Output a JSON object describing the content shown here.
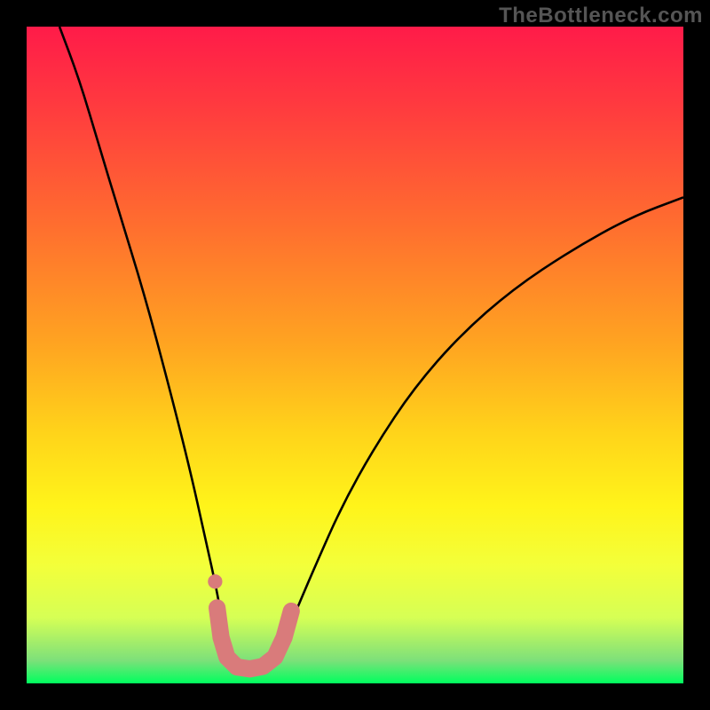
{
  "watermark": "TheBottleneck.com",
  "chart_data": {
    "type": "line",
    "title": "",
    "xlabel": "",
    "ylabel": "",
    "xlim": [
      0,
      100
    ],
    "ylim": [
      0,
      100
    ],
    "grid": false,
    "legend": false,
    "curve": {
      "description": "V-shaped bottleneck curve with minimum near x≈33",
      "points": [
        {
          "x": 5,
          "y": 100
        },
        {
          "x": 8,
          "y": 92
        },
        {
          "x": 11,
          "y": 82
        },
        {
          "x": 14,
          "y": 72
        },
        {
          "x": 18,
          "y": 59
        },
        {
          "x": 22,
          "y": 44
        },
        {
          "x": 25,
          "y": 32
        },
        {
          "x": 27,
          "y": 23
        },
        {
          "x": 29,
          "y": 14
        },
        {
          "x": 30,
          "y": 8
        },
        {
          "x": 31,
          "y": 4
        },
        {
          "x": 33,
          "y": 2
        },
        {
          "x": 35,
          "y": 2
        },
        {
          "x": 37,
          "y": 3
        },
        {
          "x": 39,
          "y": 6
        },
        {
          "x": 41,
          "y": 11
        },
        {
          "x": 44,
          "y": 18
        },
        {
          "x": 48,
          "y": 27
        },
        {
          "x": 53,
          "y": 36
        },
        {
          "x": 59,
          "y": 45
        },
        {
          "x": 66,
          "y": 53
        },
        {
          "x": 74,
          "y": 60
        },
        {
          "x": 83,
          "y": 66
        },
        {
          "x": 92,
          "y": 71
        },
        {
          "x": 100,
          "y": 74
        }
      ]
    },
    "highlight_band": {
      "description": "thick pink U segment at curve bottom",
      "points": [
        {
          "x": 29.0,
          "y": 11.5
        },
        {
          "x": 29.6,
          "y": 7.0
        },
        {
          "x": 30.5,
          "y": 4.0
        },
        {
          "x": 32.0,
          "y": 2.5
        },
        {
          "x": 34.0,
          "y": 2.2
        },
        {
          "x": 36.0,
          "y": 2.6
        },
        {
          "x": 37.8,
          "y": 4.0
        },
        {
          "x": 39.2,
          "y": 7.0
        },
        {
          "x": 40.3,
          "y": 11.0
        }
      ]
    },
    "highlight_dot": {
      "x": 28.7,
      "y": 15.5
    },
    "green_band": {
      "y_start": 1.0,
      "y_end": 3.5,
      "color_top": "#7de07a",
      "color_bottom": "#00ff5e"
    },
    "background_gradient": {
      "stops": [
        {
          "offset": 0.0,
          "color": "#ff1b49"
        },
        {
          "offset": 0.12,
          "color": "#ff3a3f"
        },
        {
          "offset": 0.3,
          "color": "#ff6d2f"
        },
        {
          "offset": 0.48,
          "color": "#ffa321"
        },
        {
          "offset": 0.62,
          "color": "#ffd41a"
        },
        {
          "offset": 0.73,
          "color": "#fff41a"
        },
        {
          "offset": 0.82,
          "color": "#f3ff3a"
        },
        {
          "offset": 0.9,
          "color": "#d6ff55"
        },
        {
          "offset": 0.965,
          "color": "#7de07a"
        },
        {
          "offset": 1.0,
          "color": "#00ff5e"
        }
      ]
    },
    "colors": {
      "curve": "#000000",
      "highlight": "#d97b7b",
      "frame": "#000000"
    }
  }
}
